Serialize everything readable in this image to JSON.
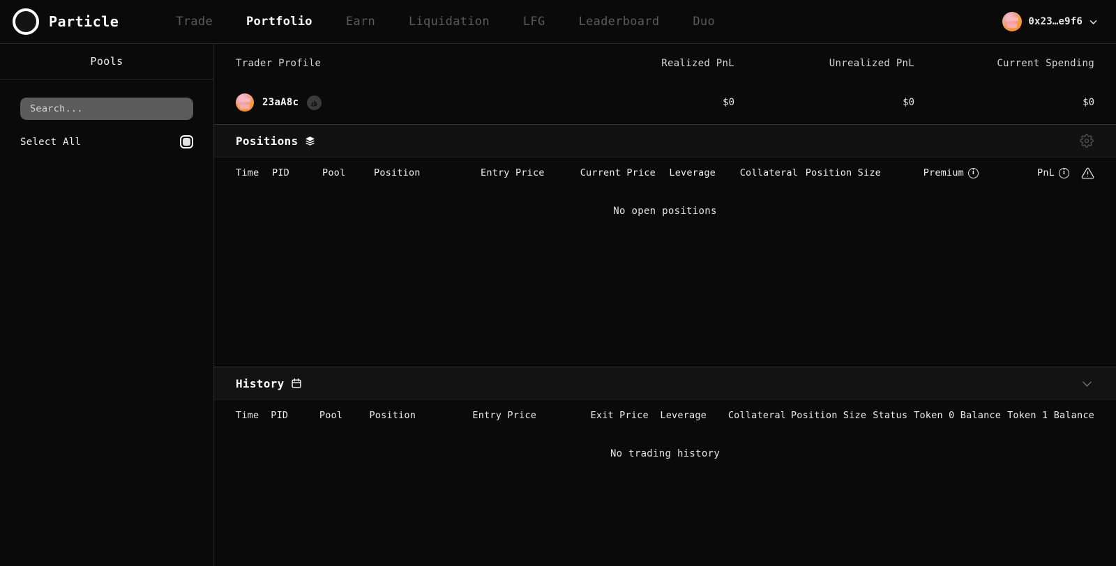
{
  "header": {
    "brand": "Particle",
    "logo_icon": "particle-ring-logo",
    "nav": [
      {
        "label": "Trade",
        "active": false
      },
      {
        "label": "Portfolio",
        "active": true
      },
      {
        "label": "Earn",
        "active": false
      },
      {
        "label": "Liquidation",
        "active": false
      },
      {
        "label": "LFG",
        "active": false
      },
      {
        "label": "Leaderboard",
        "active": false
      },
      {
        "label": "Duo",
        "active": false
      }
    ],
    "wallet": {
      "address": "0x23…e9f6",
      "avatar_icon": "wallet-avatar",
      "chevron_icon": "chevron-down-icon"
    }
  },
  "sidebar": {
    "title": "Pools",
    "search_placeholder": "Search...",
    "search_value": "",
    "select_all_label": "Select All",
    "select_all_checked": true
  },
  "profile": {
    "columns": {
      "name": "Trader Profile",
      "realized": "Realized PnL",
      "unrealized": "Unrealized PnL",
      "spending": "Current Spending"
    },
    "trader": {
      "name": "23aA8c",
      "avatar_icon": "trader-avatar",
      "badge_icon": "stats-badge-icon",
      "realized_pnl": "$0",
      "unrealized_pnl": "$0",
      "current_spending": "$0"
    }
  },
  "positions": {
    "title": "Positions",
    "title_icon": "layers-icon",
    "settings_icon": "gear-icon",
    "columns": {
      "time": "Time",
      "pid": "PID",
      "pool": "Pool",
      "position": "Position",
      "entry_price": "Entry Price",
      "current_price": "Current Price",
      "leverage": "Leverage",
      "collateral": "Collateral",
      "position_size": "Position Size",
      "premium": "Premium",
      "pnl": "PnL"
    },
    "premium_info_icon": "info-icon",
    "pnl_info_icon": "info-icon",
    "warning_icon": "warning-triangle-icon",
    "empty_text": "No open positions",
    "rows": []
  },
  "history": {
    "title": "History",
    "title_icon": "calendar-icon",
    "collapse_icon": "chevron-down-icon",
    "columns": {
      "time": "Time",
      "pid": "PID",
      "pool": "Pool",
      "position": "Position",
      "entry_price": "Entry Price",
      "exit_price": "Exit Price",
      "leverage": "Leverage",
      "collateral": "Collateral",
      "position_size": "Position Size",
      "status": "Status",
      "token0_balance": "Token 0 Balance",
      "token1_balance": "Token 1 Balance"
    },
    "empty_text": "No trading history",
    "rows": []
  },
  "colors": {
    "background": "#0a0a0a",
    "panel": "#121212",
    "border": "#262626",
    "text": "#f2f2f2",
    "muted": "#5a5a5a",
    "search_field": "#5b5b5b",
    "accent_avatar": "#f79a3c"
  }
}
